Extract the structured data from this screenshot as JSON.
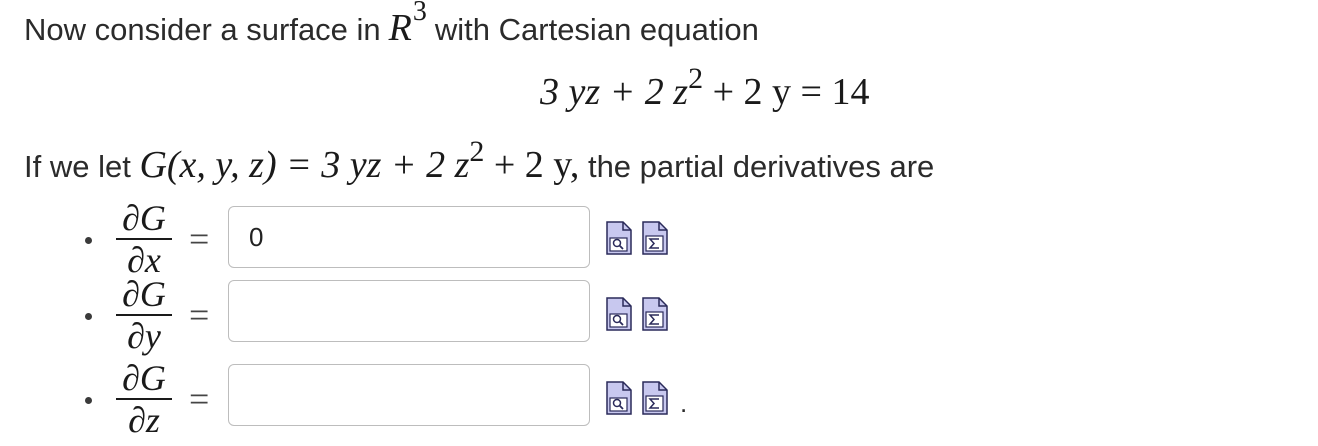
{
  "intro": {
    "before": "Now consider a surface in",
    "space_var": "R",
    "space_exp": "3",
    "after": "with Cartesian equation"
  },
  "equation": {
    "part1": "3 yz + 2 z",
    "exp": "2",
    "part2": " + 2 y = 14"
  },
  "let_line": {
    "prefix": "If we let",
    "g_def": "G(x, y, z) = 3 yz + 2 z",
    "exp": "2",
    "g_tail": " + 2 y,",
    "suffix": "the partial derivatives are"
  },
  "derivatives": [
    {
      "numerator": "∂G",
      "denominator": "∂x",
      "equals": "=",
      "value": "0"
    },
    {
      "numerator": "∂G",
      "denominator": "∂y",
      "equals": "=",
      "value": ""
    },
    {
      "numerator": "∂G",
      "denominator": "∂z",
      "equals": "=",
      "value": ""
    }
  ],
  "icons": {
    "preview": "preview-answer-icon",
    "formula": "formula-editor-icon",
    "fill": "#c8c8ef",
    "stroke": "#2a2a5a"
  },
  "trailing_punctuation": "."
}
